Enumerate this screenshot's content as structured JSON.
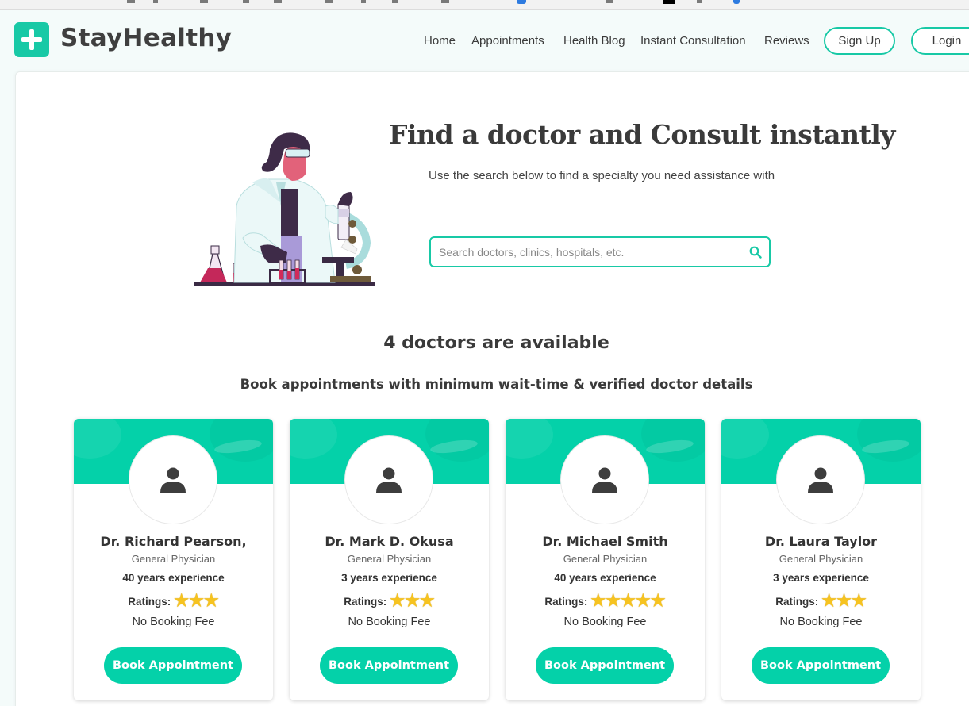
{
  "brand": {
    "name": "StayHealthy"
  },
  "nav": {
    "links": [
      "Home",
      "Appointments",
      "Health Blog",
      "Instant Consultation",
      "Reviews"
    ],
    "signup_label": "Sign Up",
    "login_label": "Login"
  },
  "hero": {
    "title": "Find a doctor and Consult instantly",
    "subtitle": "Use the search below to find a specialty you need assistance with",
    "search_placeholder": "Search doctors, clinics, hospitals, etc.",
    "search_value": ""
  },
  "results": {
    "count_text": "4 doctors are available",
    "subtitle": "Book appointments with minimum wait-time & verified doctor details"
  },
  "rating_label": "Ratings:",
  "doctors": [
    {
      "name": "Dr. Richard Pearson,",
      "specialty": "General Physician",
      "experience": "40 years experience",
      "stars": 3,
      "fee": "No Booking Fee",
      "button": "Book Appointment"
    },
    {
      "name": "Dr. Mark D. Okusa",
      "specialty": "General Physician",
      "experience": "3 years experience",
      "stars": 3,
      "fee": "No Booking Fee",
      "button": "Book Appointment"
    },
    {
      "name": "Dr. Michael Smith",
      "specialty": "General Physician",
      "experience": "40 years experience",
      "stars": 5,
      "fee": "No Booking Fee",
      "button": "Book Appointment"
    },
    {
      "name": "Dr. Laura Taylor",
      "specialty": "General Physician",
      "experience": "3 years experience",
      "stars": 3,
      "fee": "No Booking Fee",
      "button": "Book Appointment"
    }
  ],
  "colors": {
    "accent": "#04d1a9",
    "logo": "#18c9a6",
    "text": "#3a3a3a"
  },
  "icons": {
    "logo": "plus-icon",
    "search": "search-icon",
    "avatar": "user-icon",
    "rating": "star-icon"
  }
}
